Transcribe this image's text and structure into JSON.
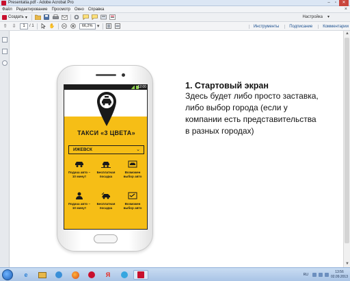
{
  "window": {
    "title": "Presentatia.pdf - Adobe Acrobat Pro",
    "controls": [
      "–",
      "▫",
      "✕"
    ]
  },
  "menubar": {
    "items": [
      "Файл",
      "Редактирование",
      "Просмотр",
      "Окно",
      "Справка"
    ],
    "close_glyph": "×"
  },
  "toolbar": {
    "create_label": "Создать",
    "customize_label": "Настройка",
    "customize_arrow": "▾"
  },
  "navbar": {
    "current_page": "1",
    "total_pages": "/ 1",
    "zoom_value": "66,2%",
    "links": [
      "Инструменты",
      "Подписание",
      "Комментарии"
    ]
  },
  "slide": {
    "phone_time": "12:00",
    "app_title": "ТАКСИ «3 ЦВЕТА»",
    "city_select_value": "ИЖЕВСК",
    "features": [
      {
        "icon": "car-icon",
        "label": "Подача авто – 10 минут"
      },
      {
        "icon": "car-parked-icon",
        "label": "Бесплатная посадка"
      },
      {
        "icon": "car-choice-icon",
        "label": "Возможен выбор авто"
      },
      {
        "icon": "driver-icon",
        "label": "Подача авто – 10 минут"
      },
      {
        "icon": "tow-car-icon",
        "label": "Бесплатная посадка"
      },
      {
        "icon": "car-list-icon",
        "label": "Возможен выбор авто"
      }
    ],
    "heading": "1. Стартовый экран",
    "description": "Здесь будет либо просто заставка, либо выбор города (если у компании есть представительства в разных городах)"
  },
  "taskbar": {
    "language": "RU",
    "time": "13:56",
    "date": "02.09.2013",
    "pinned": [
      "ie-icon",
      "explorer-icon",
      "media-icon",
      "firefox-icon",
      "acrobat-shield-icon",
      "yandex-icon",
      "skype-icon",
      "acrobat-icon"
    ]
  },
  "colors": {
    "brand_yellow": "#f6be16",
    "acrobat_red": "#c8102e",
    "link_blue": "#1b4f8f"
  }
}
